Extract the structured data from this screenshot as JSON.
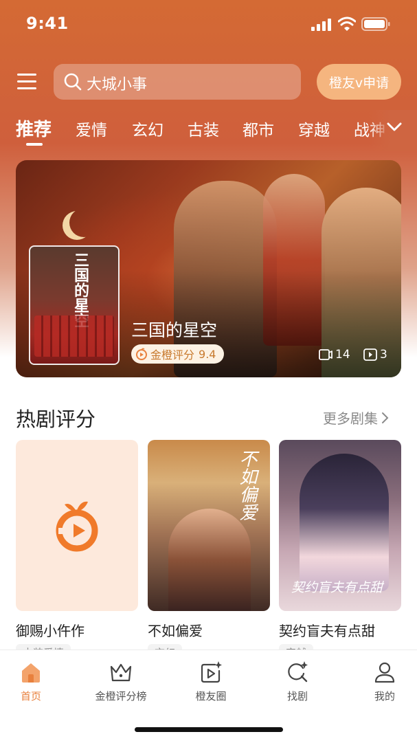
{
  "status_bar": {
    "time": "9:41"
  },
  "header": {
    "search_text": "大城小事",
    "apply_button": "橙友v申请"
  },
  "tabs": [
    "推荐",
    "爱情",
    "玄幻",
    "古装",
    "都市",
    "穿越",
    "战神"
  ],
  "banner": {
    "poster_title": "三国的星空",
    "title": "三国的星空",
    "rating_label": "金橙评分",
    "rating_value": "9.4",
    "stat_a": "14",
    "stat_b": "3"
  },
  "section": {
    "title": "热剧评分",
    "more": "更多剧集"
  },
  "cards": [
    {
      "title": "御赐小仵作",
      "tag": "古装爱情"
    },
    {
      "title": "不如偏爱",
      "tag": "玄幻",
      "poster_text": "不如偏爱"
    },
    {
      "title": "契约盲夫有点甜",
      "tag": "穿越",
      "poster_text": "契约盲夫有点甜"
    }
  ],
  "bottom_nav": [
    {
      "label": "首页",
      "icon": "home-icon",
      "active": true
    },
    {
      "label": "金橙评分榜",
      "icon": "crown-icon"
    },
    {
      "label": "橙友圈",
      "icon": "video-sparkle-icon"
    },
    {
      "label": "找剧",
      "icon": "search-sparkle-icon"
    },
    {
      "label": "我的",
      "icon": "person-icon"
    }
  ],
  "colors": {
    "accent": "#e8803d",
    "header_top": "#d46a34",
    "badge_text": "#c87a2e"
  }
}
